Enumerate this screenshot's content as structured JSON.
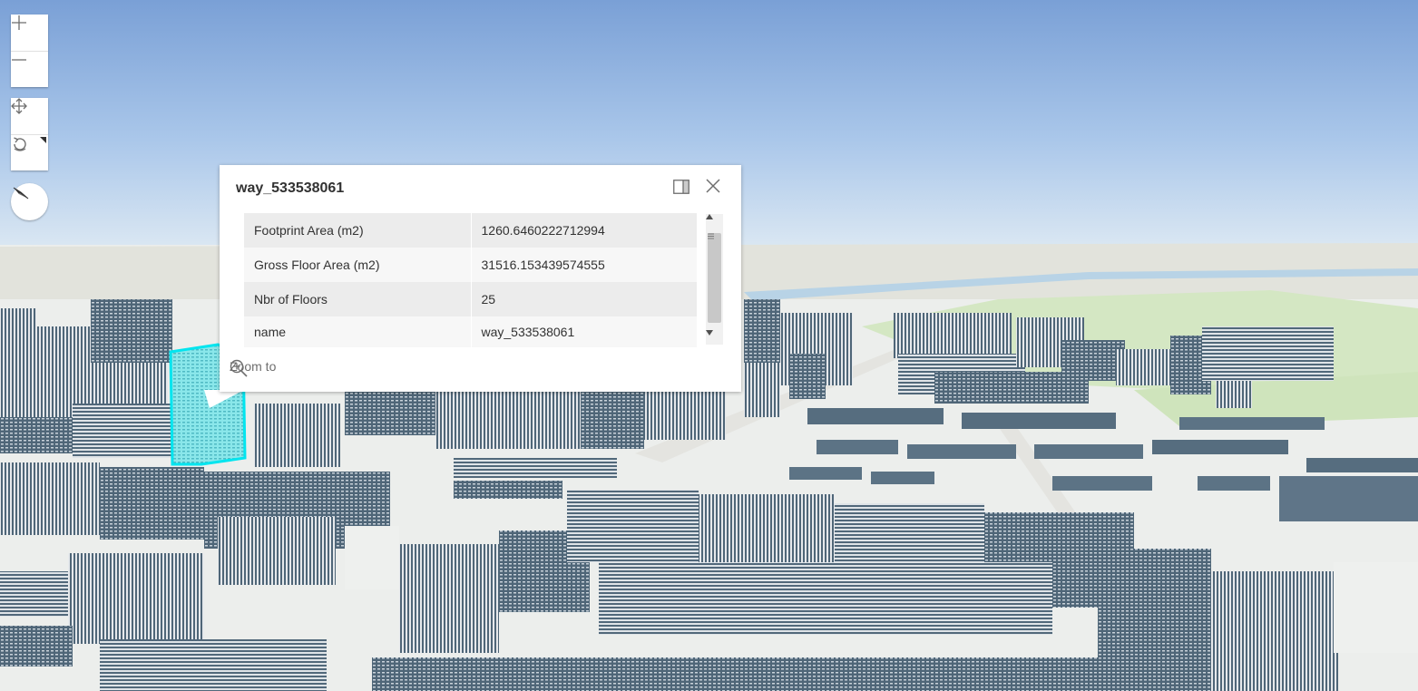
{
  "map": {
    "view_type": "3D scene",
    "selected_building_highlight_color": "#00e5ef"
  },
  "controls": {
    "zoom_in": "+",
    "zoom_out": "—",
    "pan_icon": "move-icon",
    "rotate_icon": "rotate-icon",
    "compass_icon": "compass-icon"
  },
  "popup": {
    "title": "way_533538061",
    "dock_icon": "dock-icon",
    "close_icon": "close-icon",
    "attributes": [
      {
        "key": "Footprint Area (m2)",
        "value": "1260.6460222712994"
      },
      {
        "key": "Gross Floor Area (m2)",
        "value": "31516.153439574555"
      },
      {
        "key": "Nbr of Floors",
        "value": "25"
      },
      {
        "key": "name",
        "value": "way_533538061"
      }
    ],
    "zoom_to_label": "Zoom to"
  }
}
